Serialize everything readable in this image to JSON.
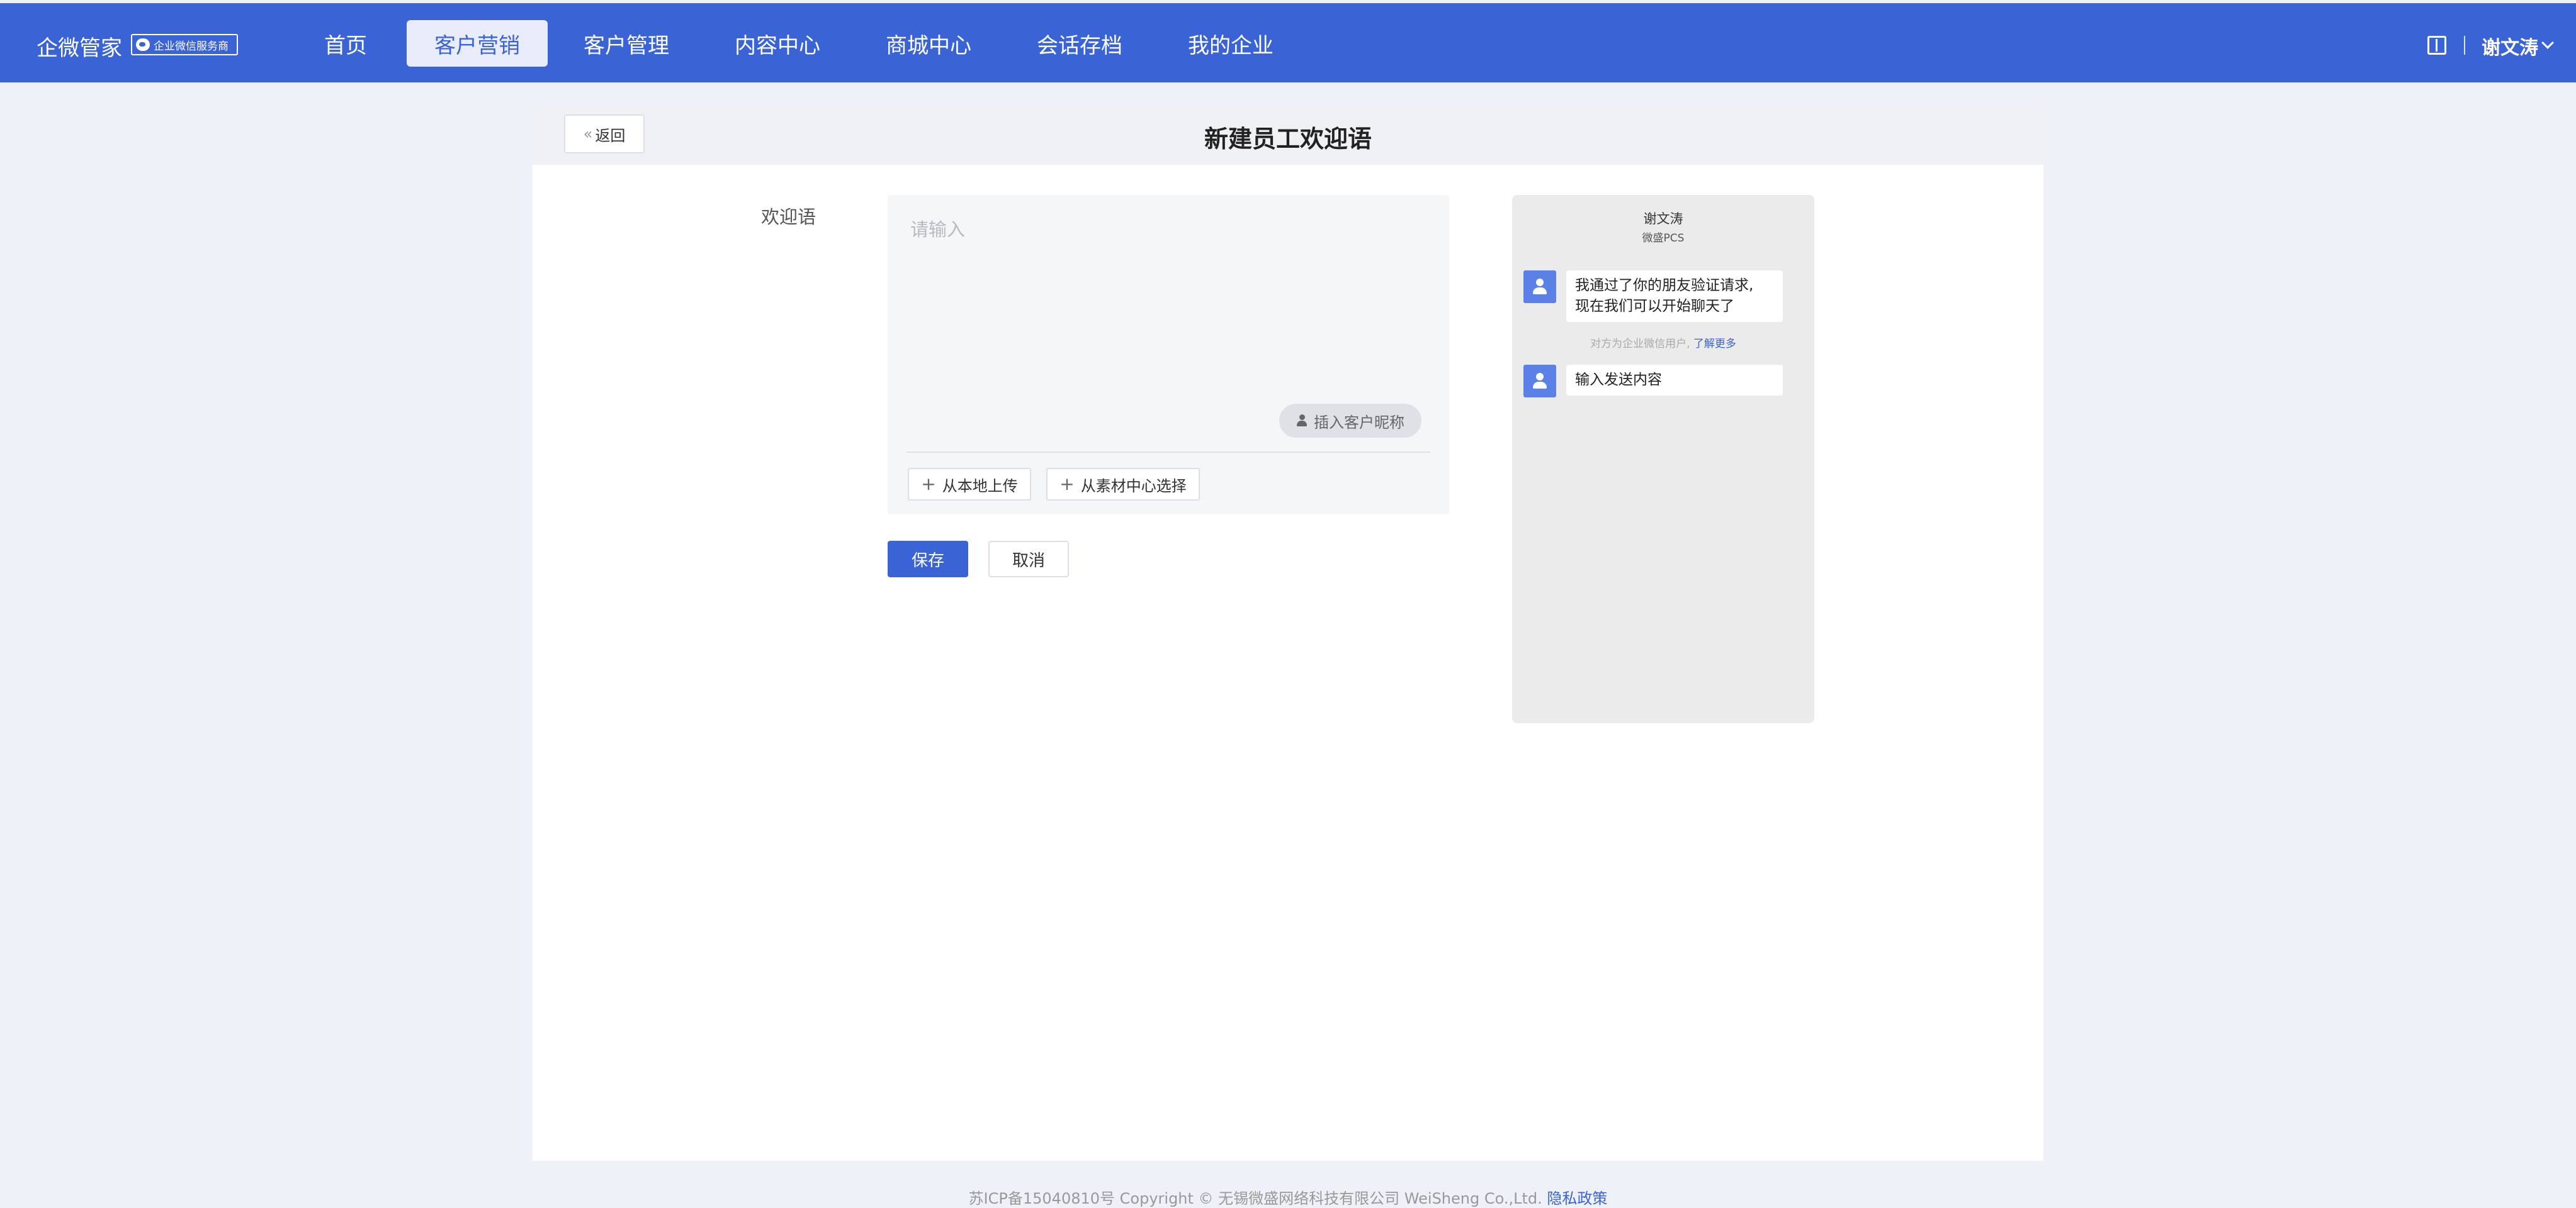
{
  "brand": {
    "name": "企微管家",
    "badge": "企业微信服务商"
  },
  "nav": {
    "items": [
      {
        "label": "首页"
      },
      {
        "label": "客户营销",
        "active": true
      },
      {
        "label": "客户管理"
      },
      {
        "label": "内容中心"
      },
      {
        "label": "商城中心"
      },
      {
        "label": "会话存档"
      },
      {
        "label": "我的企业"
      }
    ],
    "user": "谢文涛",
    "right_icon": "book-icon"
  },
  "page": {
    "back_label": "返回",
    "title": "新建员工欢迎语"
  },
  "form": {
    "label": "欢迎语",
    "placeholder": "请输入",
    "value": "",
    "insert_nick_label": "插入客户昵称",
    "upload_local_label": "从本地上传",
    "upload_library_label": "从素材中心选择",
    "save_label": "保存",
    "cancel_label": "取消"
  },
  "preview": {
    "name": "谢文涛",
    "subtitle": "微盛PCS",
    "message1_line1": "我通过了你的朋友验证请求,",
    "message1_line2": "现在我们可以开始聊天了",
    "note": "对方为企业微信用户,",
    "note_link": "了解更多",
    "message2": "输入发送内容"
  },
  "footer": {
    "text": "苏ICP备15040810号 Copyright © 无锡微盛网络科技有限公司 WeiSheng Co.,Ltd.",
    "link": "隐私政策"
  },
  "colors": {
    "primary": "#3a63d6",
    "page_bg": "#eef1f8"
  }
}
